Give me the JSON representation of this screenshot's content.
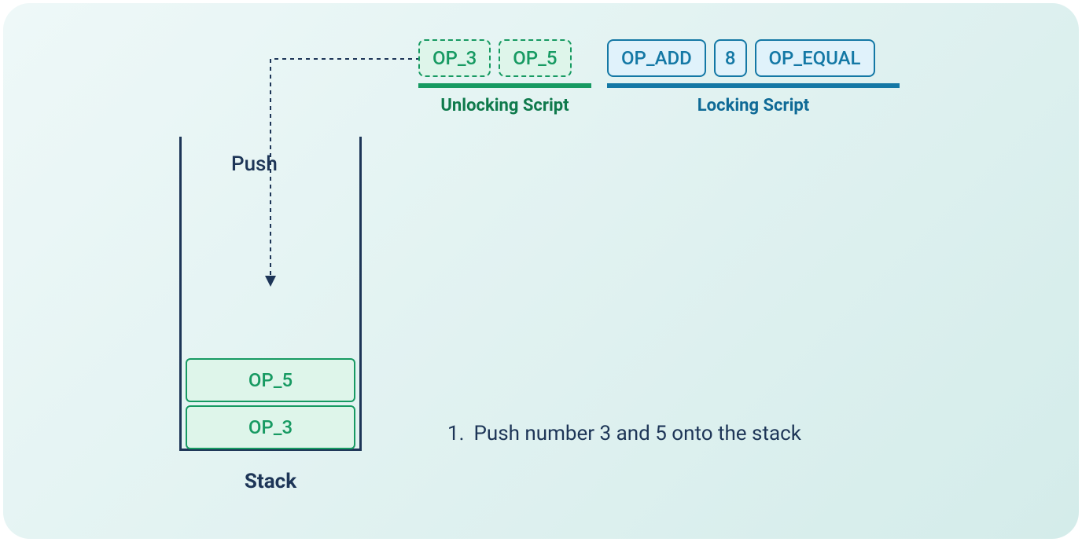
{
  "stack": {
    "label": "Stack",
    "push_label": "Push",
    "items": [
      "OP_5",
      "OP_3"
    ]
  },
  "unlocking_script": {
    "label": "Unlocking Script",
    "ops": [
      "OP_3",
      "OP_5"
    ]
  },
  "locking_script": {
    "label": "Locking Script",
    "ops": [
      "OP_ADD",
      "8",
      "OP_EQUAL"
    ]
  },
  "step": {
    "number": "1.",
    "text": "Push number 3 and 5 onto the stack"
  }
}
